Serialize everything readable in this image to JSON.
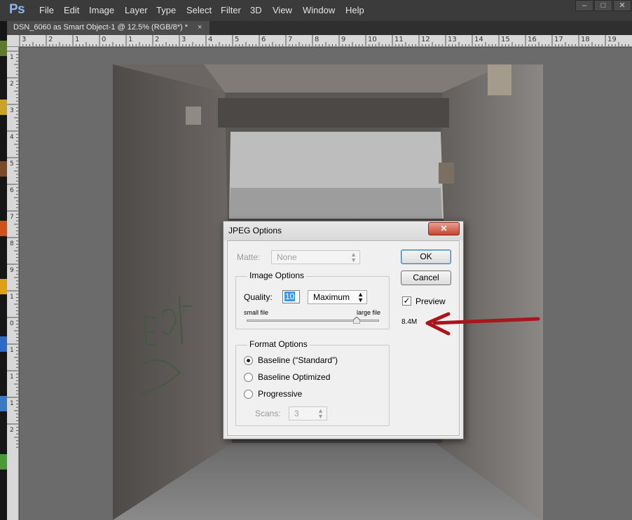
{
  "app": {
    "logo": "Ps",
    "menu": [
      "File",
      "Edit",
      "Image",
      "Layer",
      "Type",
      "Select",
      "Filter",
      "3D",
      "View",
      "Window",
      "Help"
    ]
  },
  "window_controls": {
    "minimize": "–",
    "maximize": "□",
    "close": "✕"
  },
  "document_tab": {
    "title": "DSN_6060 as Smart Object-1 @ 12.5% (RGB/8*) *",
    "close": "×"
  },
  "ruler_top": [
    "3",
    "2",
    "1",
    "0",
    "1",
    "2",
    "3",
    "4",
    "5",
    "6",
    "7",
    "8",
    "9",
    "10",
    "11",
    "12",
    "13",
    "14",
    "15",
    "16",
    "17",
    "18",
    "19"
  ],
  "ruler_left": [
    "1",
    "2",
    "3",
    "4",
    "5",
    "6",
    "7",
    "8",
    "9",
    "1",
    "0",
    "1",
    "1",
    "1",
    "2"
  ],
  "dialog": {
    "title": "JPEG Options",
    "close_glyph": "✕",
    "matte_label": "Matte:",
    "matte_value": "None",
    "image_options_title": "Image Options",
    "quality_label": "Quality:",
    "quality_value": "10",
    "quality_preset": "Maximum",
    "slider_min_label": "small file",
    "slider_max_label": "large file",
    "quality_fraction": 0.83,
    "format_options_title": "Format Options",
    "formats": [
      "Baseline (“Standard”)",
      "Baseline Optimized",
      "Progressive"
    ],
    "selected_format": "Baseline (“Standard”)",
    "scans_label": "Scans:",
    "scans_value": "3",
    "ok_label": "OK",
    "cancel_label": "Cancel",
    "preview_label": "Preview",
    "preview_checked": true,
    "file_size": "8.4M"
  },
  "annotation": {
    "arrow_color": "#a8151a"
  },
  "colors": {
    "menubar": "#3b3b3b",
    "canvas_bg": "#6b6b6b",
    "dialog_bg": "#f0f0f0",
    "close_red": "#c7432f"
  }
}
